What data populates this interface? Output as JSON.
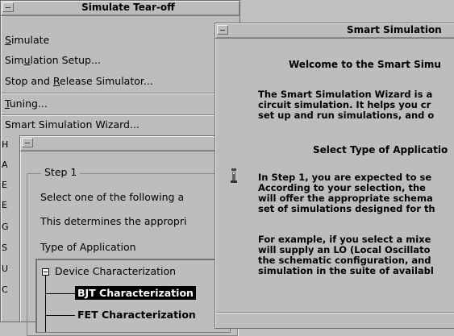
{
  "tearoff": {
    "title": "Simulate Tear-off",
    "items": [
      {
        "label": "Simulate",
        "mnemonic": "S"
      },
      {
        "label": "Simulation Setup...",
        "mnemonic": "u"
      },
      {
        "label": "Stop and Release Simulator...",
        "mnemonic": "R"
      },
      {
        "label": "Tuning...",
        "mnemonic": "T"
      },
      {
        "label": "Smart Simulation Wizard...",
        "mnemonic": ""
      }
    ],
    "partial_letters": [
      "H",
      "A",
      "E",
      "E",
      "G",
      "S",
      "U",
      "C"
    ]
  },
  "step_window": {
    "group_label": "Step 1",
    "line1": "Select one of the following a",
    "line2": "This determines the appropri",
    "line3": "Type of Application",
    "tree": {
      "root": "Device Characterization",
      "children": [
        "BJT Characterization",
        "FET Characterization"
      ],
      "selected_index": 0
    }
  },
  "wizard": {
    "title": "Smart Simulation",
    "welcome": "Welcome to the Smart Simu",
    "para1": [
      "The Smart Simulation Wizard is a",
      "circuit simulation. It helps you cr",
      "set up and run simulations, and o"
    ],
    "heading": "Select Type of Applicatio",
    "para2": [
      "In Step 1, you are expected to se",
      "According to your selection, the",
      "will offer the appropriate schema",
      "set of simulations designed for th"
    ],
    "para3": [
      "For example, if you select a mixe",
      "will supply an LO (Local Oscillato",
      "the schematic configuration, and",
      "simulation in the suite of availabl"
    ],
    "side_icon": "info-scroll-icon"
  }
}
